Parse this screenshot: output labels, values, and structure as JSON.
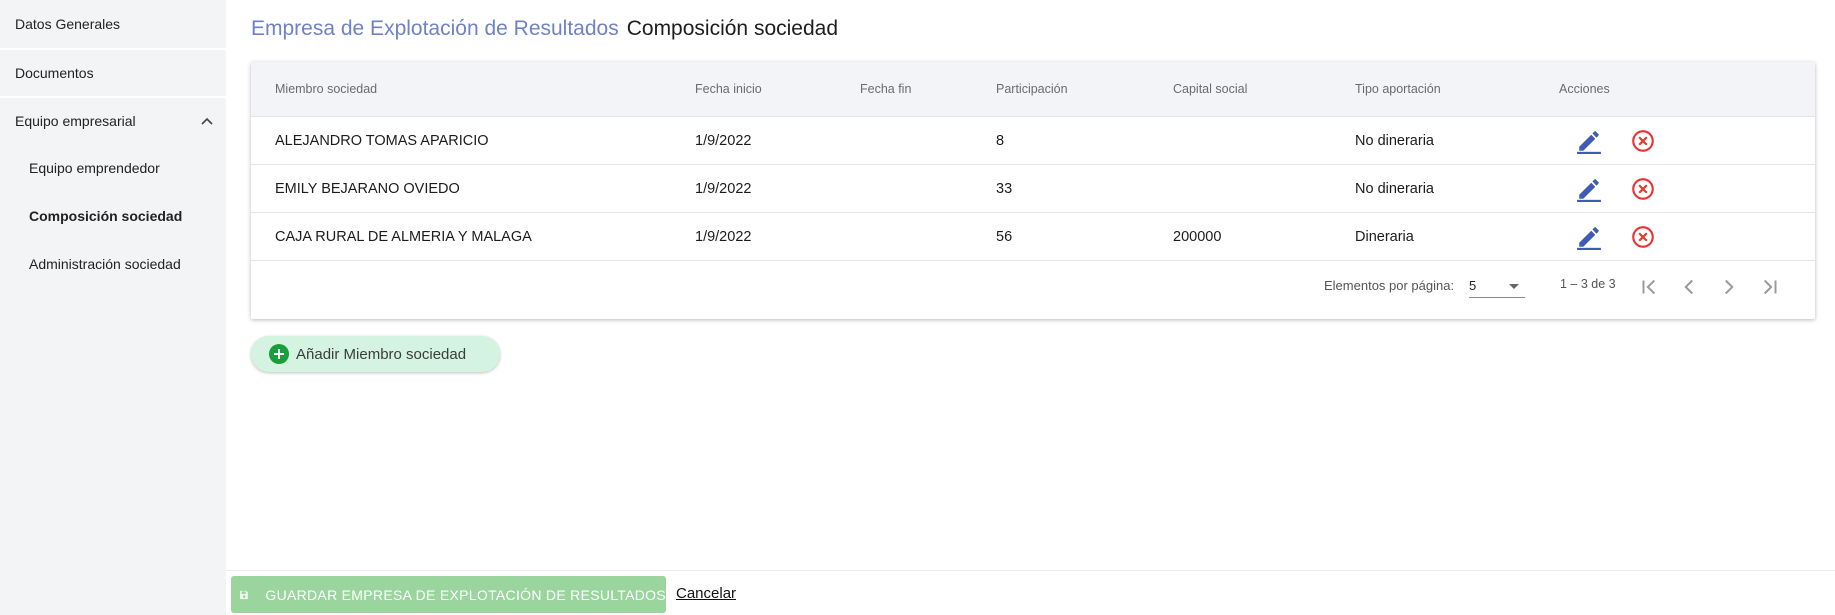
{
  "sidebar": {
    "items": [
      {
        "label": "Datos Generales"
      },
      {
        "label": "Documentos"
      },
      {
        "label": "Equipo empresarial"
      },
      {
        "label": "Equipo emprendedor"
      },
      {
        "label": "Composición sociedad"
      },
      {
        "label": "Administración sociedad"
      }
    ]
  },
  "header": {
    "entity": "Empresa de Explotación de Resultados",
    "page": "Composición sociedad"
  },
  "table": {
    "columns": [
      "Miembro sociedad",
      "Fecha inicio",
      "Fecha fin",
      "Participación",
      "Capital social",
      "Tipo aportación",
      "Acciones"
    ],
    "rows": [
      {
        "miembro": "ALEJANDRO TOMAS APARICIO",
        "inicio": "1/9/2022",
        "fin": "",
        "participacion": "8",
        "capital": "",
        "tipo": "No dineraria"
      },
      {
        "miembro": "EMILY BEJARANO OVIEDO",
        "inicio": "1/9/2022",
        "fin": "",
        "participacion": "33",
        "capital": "",
        "tipo": "No dineraria"
      },
      {
        "miembro": "CAJA RURAL DE ALMERIA Y MALAGA",
        "inicio": "1/9/2022",
        "fin": "",
        "participacion": "56",
        "capital": "200000",
        "tipo": "Dineraria"
      }
    ]
  },
  "paginator": {
    "label": "Elementos por página:",
    "page_size": "5",
    "range": "1 – 3 de 3"
  },
  "add_button": {
    "label": "Añadir Miembro sociedad"
  },
  "footer": {
    "save_label": "GUARDAR EMPRESA DE EXPLOTACIÓN DE RESULTADOS",
    "cancel_label": "Cancelar"
  },
  "colors": {
    "accent": "#6f82c9",
    "edit_icon": "#3f5bb5",
    "delete_icon": "#e53935",
    "add_bg": "#d4f3e1",
    "add_icon": "#1a9d3a",
    "save_bg": "#9ad59e"
  },
  "icons": {
    "chevron": "chevron-up-icon",
    "edit": "pencil-icon",
    "delete": "cancel-circle-icon",
    "add": "plus-circle-icon",
    "save": "floppy-disk-icon"
  }
}
